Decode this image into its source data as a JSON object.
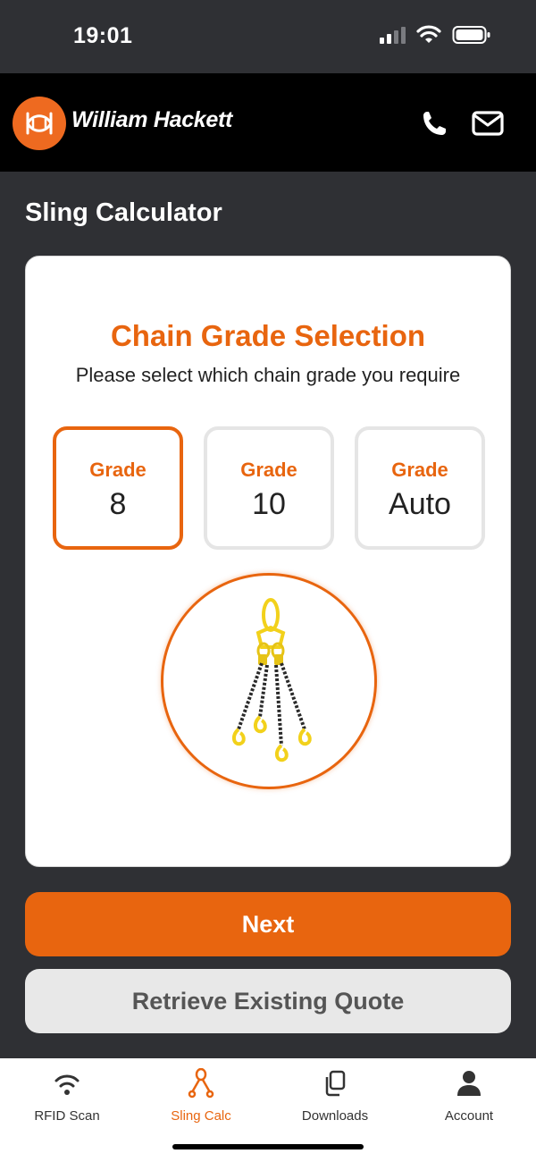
{
  "status_bar": {
    "time": "19:01"
  },
  "header": {
    "brand": "William Hackett",
    "icons": [
      "phone-icon",
      "mail-icon"
    ]
  },
  "page": {
    "title": "Sling Calculator"
  },
  "card": {
    "title": "Chain Grade Selection",
    "subtitle": "Please select which chain grade you require",
    "grades": [
      {
        "label": "Grade",
        "value": "8",
        "selected": true
      },
      {
        "label": "Grade",
        "value": "10",
        "selected": false
      },
      {
        "label": "Grade",
        "value": "Auto",
        "selected": false
      }
    ]
  },
  "buttons": {
    "next": "Next",
    "retrieve": "Retrieve Existing Quote"
  },
  "tab_bar": {
    "items": [
      {
        "label": "RFID Scan",
        "icon": "wifi-icon",
        "active": false
      },
      {
        "label": "Sling Calc",
        "icon": "sling-icon",
        "active": true
      },
      {
        "label": "Downloads",
        "icon": "copy-icon",
        "active": false
      },
      {
        "label": "Account",
        "icon": "person-icon",
        "active": false
      }
    ]
  },
  "colors": {
    "accent": "#e8650f",
    "background": "#2f3034",
    "header": "#000000"
  }
}
